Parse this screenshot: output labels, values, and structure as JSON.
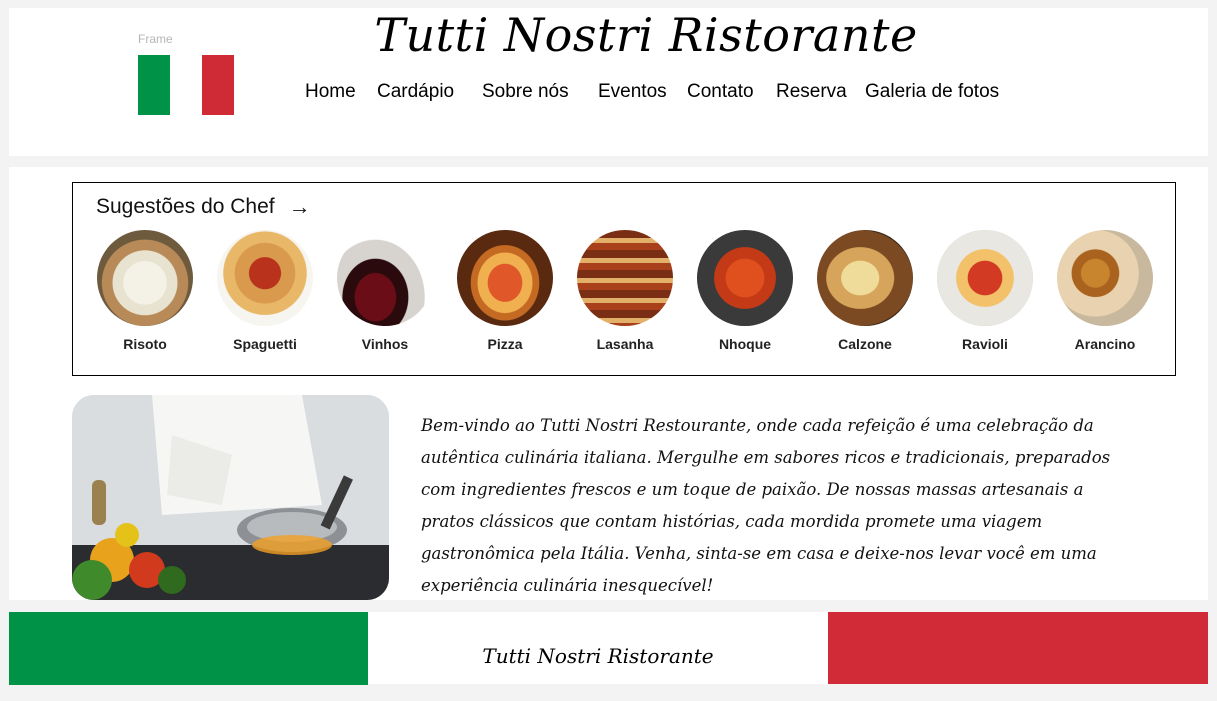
{
  "header": {
    "frame_label": "Frame",
    "title": "Tutti Nostri Ristorante",
    "flag_colors": {
      "green": "#009246",
      "white": "#ffffff",
      "red": "#ce2b37"
    },
    "nav": [
      "Home",
      "Cardápio",
      "Sobre nós",
      "Eventos",
      "Contato",
      "Reserva",
      "Galeria de fotos"
    ]
  },
  "suggestions": {
    "title": "Sugestões do Chef",
    "arrow_icon": "arrow-right-icon",
    "dishes": [
      {
        "name": "Risoto"
      },
      {
        "name": "Spaguetti"
      },
      {
        "name": "Vinhos"
      },
      {
        "name": "Pizza"
      },
      {
        "name": "Lasanha"
      },
      {
        "name": "Nhoque"
      },
      {
        "name": "Calzone"
      },
      {
        "name": "Ravioli"
      },
      {
        "name": "Arancino"
      }
    ]
  },
  "welcome_text": "Bem-vindo ao Tutti Nostri Restourante, onde cada refeição é uma celebração da autêntica culinária italiana. Mergulhe em sabores ricos e tradicionais, preparados com ingredientes frescos e um toque de paixão. De nossas massas artesanais a pratos clássicos que contam histórias, cada mordida promete uma viagem gastronômica pela Itália. Venha, sinta-se em casa e deixe-nos levar você em uma experiência culinária inesquecível!",
  "footer": {
    "title": "Tutti Nostri Ristorante",
    "colors": {
      "green": "#009246",
      "red": "#d12b38"
    }
  }
}
